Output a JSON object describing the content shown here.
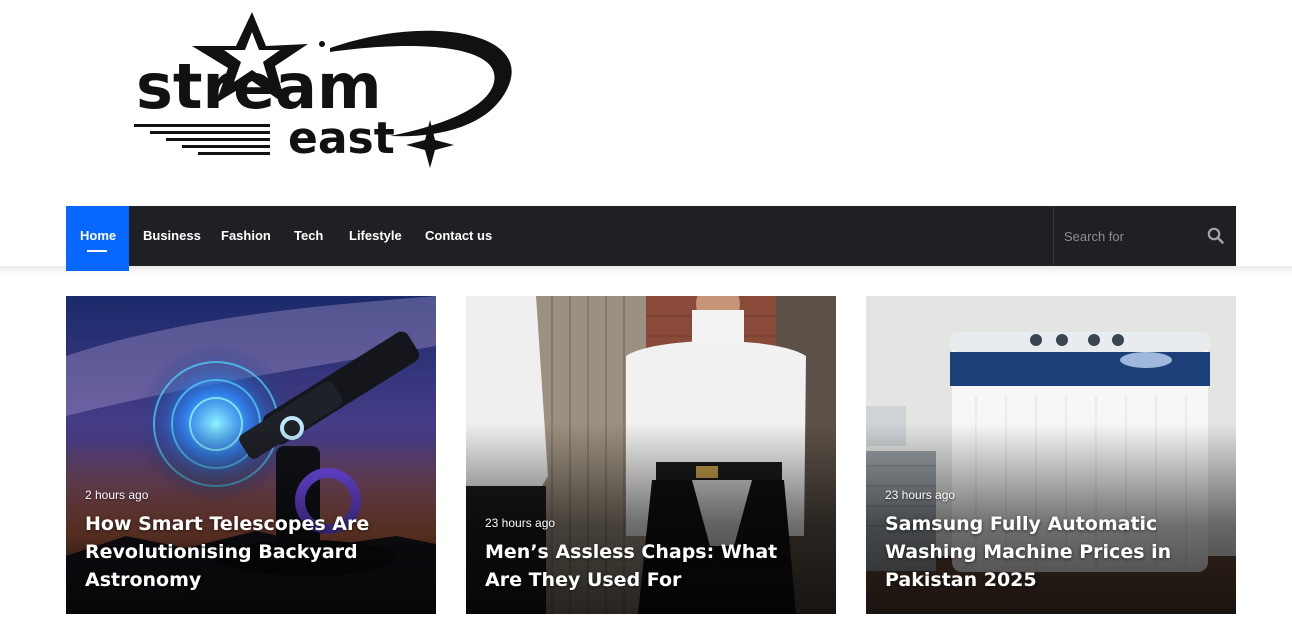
{
  "logo": {
    "text_line1": "stream",
    "text_line2": "east",
    "alt": "Stream East"
  },
  "nav": {
    "items": [
      {
        "label": "Home",
        "active": true
      },
      {
        "label": "Business"
      },
      {
        "label": "Fashion"
      },
      {
        "label": "Tech"
      },
      {
        "label": "Lifestyle"
      },
      {
        "label": "Contact us"
      }
    ],
    "search": {
      "placeholder": "Search for",
      "icon": "search-icon"
    },
    "colors": {
      "bar": "#1f2024",
      "active": "#0867ff"
    }
  },
  "cards": [
    {
      "time": "2 hours ago",
      "title": "How Smart Telescopes Are Revolutionising Backyard Astronomy"
    },
    {
      "time": "23 hours ago",
      "title": "Men’s Assless Chaps: What Are They Used For"
    },
    {
      "time": "23 hours ago",
      "title": "Samsung Fully Automatic Washing Machine Prices in Pakistan 2025"
    }
  ]
}
